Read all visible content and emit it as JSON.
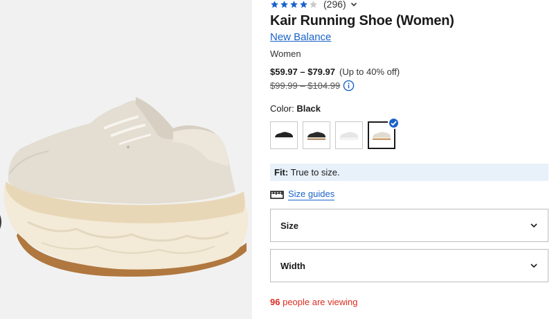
{
  "product": {
    "rating": 4,
    "rating_count": "(296)",
    "title": "Kair Running Shoe (Women)",
    "brand": "New Balance",
    "gender": "Women",
    "price_range": "$59.97 – $79.97",
    "discount_text": "(Up to 40% off)",
    "original_price": "$99.99 – $104.99"
  },
  "color": {
    "label": "Color:",
    "value": "Black",
    "swatches": [
      {
        "name": "black-white",
        "selected": false
      },
      {
        "name": "black-gum",
        "selected": false
      },
      {
        "name": "white",
        "selected": false
      },
      {
        "name": "sea-salt",
        "selected": true
      }
    ]
  },
  "fit": {
    "label": "Fit:",
    "value": "True to size."
  },
  "size_guides_label": "Size guides",
  "selects": {
    "size_label": "Size",
    "width_label": "Width"
  },
  "viewers": {
    "count": "96",
    "text": "people are viewing"
  },
  "colors": {
    "link": "#1a63c9",
    "alert": "#d92d20",
    "fit_bg": "#e8f0f9",
    "star": "#1a63c9"
  }
}
